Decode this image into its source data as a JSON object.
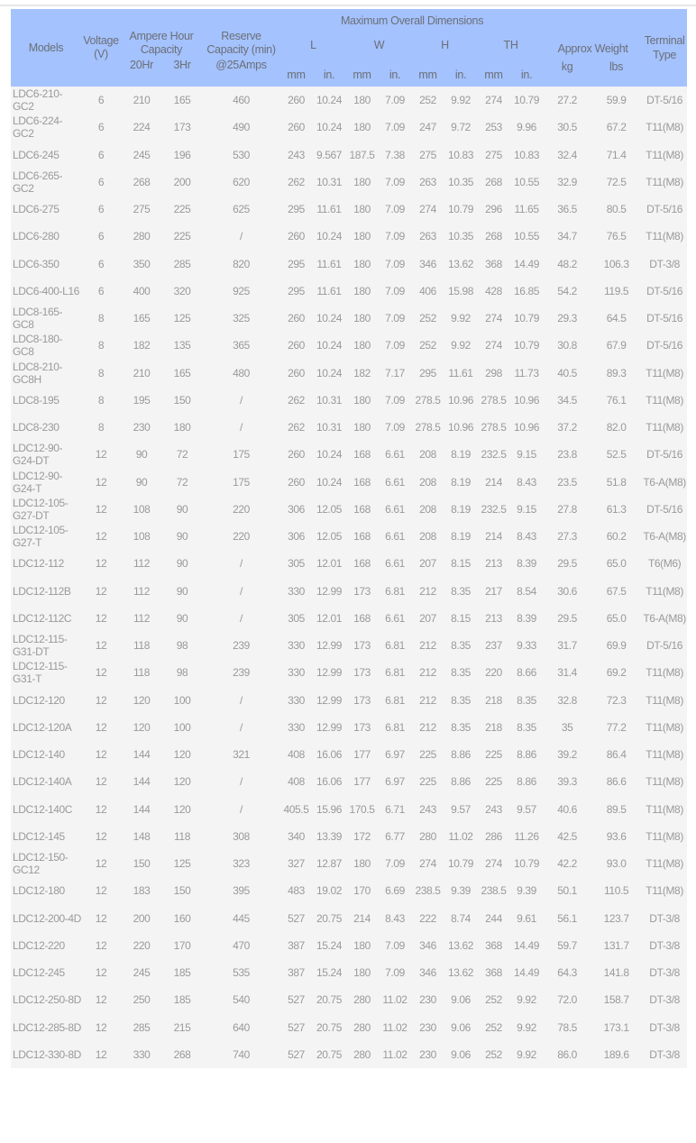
{
  "header": {
    "models": "Models",
    "voltage": "Voltage (V)",
    "ah_capacity": "Ampere Hour Capacity",
    "ah_20hr": "20Hr",
    "ah_3hr": "3Hr",
    "reserve_capacity": "Reserve Capacity (min)",
    "reserve_sub": "@25Amps",
    "max_dimensions": "Maximum Overall Dimensions",
    "dim_L": "L",
    "dim_W": "W",
    "dim_H": "H",
    "dim_TH": "TH",
    "unit_mm": "mm",
    "unit_in": "in.",
    "approx_weight": "Approx Weight",
    "weight_kg": "kg",
    "weight_lbs": "lbs",
    "terminal_type": "Terminal Type"
  },
  "rows": [
    [
      "LDC6-210-GC2",
      "6",
      "210",
      "165",
      "460",
      "260",
      "10.24",
      "180",
      "7.09",
      "252",
      "9.92",
      "274",
      "10.79",
      "27.2",
      "59.9",
      "DT-5/16"
    ],
    [
      "LDC6-224-GC2",
      "6",
      "224",
      "173",
      "490",
      "260",
      "10.24",
      "180",
      "7.09",
      "247",
      "9.72",
      "253",
      "9.96",
      "30.5",
      "67.2",
      "T11(M8)"
    ],
    [
      "LDC6-245",
      "6",
      "245",
      "196",
      "530",
      "243",
      "9.567",
      "187.5",
      "7.38",
      "275",
      "10.83",
      "275",
      "10.83",
      "32.4",
      "71.4",
      "T11(M8)"
    ],
    [
      "LDC6-265-GC2",
      "6",
      "268",
      "200",
      "620",
      "262",
      "10.31",
      "180",
      "7.09",
      "263",
      "10.35",
      "268",
      "10.55",
      "32.9",
      "72.5",
      "T11(M8)"
    ],
    [
      "LDC6-275",
      "6",
      "275",
      "225",
      "625",
      "295",
      "11.61",
      "180",
      "7.09",
      "274",
      "10.79",
      "296",
      "11.65",
      "36.5",
      "80.5",
      "DT-5/16"
    ],
    [
      "LDC6-280",
      "6",
      "280",
      "225",
      "/",
      "260",
      "10.24",
      "180",
      "7.09",
      "263",
      "10.35",
      "268",
      "10.55",
      "34.7",
      "76.5",
      "T11(M8)"
    ],
    [
      "LDC6-350",
      "6",
      "350",
      "285",
      "820",
      "295",
      "11.61",
      "180",
      "7.09",
      "346",
      "13.62",
      "368",
      "14.49",
      "48.2",
      "106.3",
      "DT-3/8"
    ],
    [
      "LDC6-400-L16",
      "6",
      "400",
      "320",
      "925",
      "295",
      "11.61",
      "180",
      "7.09",
      "406",
      "15.98",
      "428",
      "16.85",
      "54.2",
      "119.5",
      "DT-5/16"
    ],
    [
      "LDC8-165-GC8",
      "8",
      "165",
      "125",
      "325",
      "260",
      "10.24",
      "180",
      "7.09",
      "252",
      "9.92",
      "274",
      "10.79",
      "29.3",
      "64.5",
      "DT-5/16"
    ],
    [
      "LDC8-180-GC8",
      "8",
      "182",
      "135",
      "365",
      "260",
      "10.24",
      "180",
      "7.09",
      "252",
      "9.92",
      "274",
      "10.79",
      "30.8",
      "67.9",
      "DT-5/16"
    ],
    [
      "LDC8-210-GC8H",
      "8",
      "210",
      "165",
      "480",
      "260",
      "10.24",
      "182",
      "7.17",
      "295",
      "11.61",
      "298",
      "11.73",
      "40.5",
      "89.3",
      "T11(M8)"
    ],
    [
      "LDC8-195",
      "8",
      "195",
      "150",
      "/",
      "262",
      "10.31",
      "180",
      "7.09",
      "278.5",
      "10.96",
      "278.5",
      "10.96",
      "34.5",
      "76.1",
      "T11(M8)"
    ],
    [
      "LDC8-230",
      "8",
      "230",
      "180",
      "/",
      "262",
      "10.31",
      "180",
      "7.09",
      "278.5",
      "10.96",
      "278.5",
      "10.96",
      "37.2",
      "82.0",
      "T11(M8)"
    ],
    [
      "LDC12-90-G24-DT",
      "12",
      "90",
      "72",
      "175",
      "260",
      "10.24",
      "168",
      "6.61",
      "208",
      "8.19",
      "232.5",
      "9.15",
      "23.8",
      "52.5",
      "DT-5/16"
    ],
    [
      "LDC12-90-G24-T",
      "12",
      "90",
      "72",
      "175",
      "260",
      "10.24",
      "168",
      "6.61",
      "208",
      "8.19",
      "214",
      "8.43",
      "23.5",
      "51.8",
      "T6-A(M8)"
    ],
    [
      "LDC12-105-G27-DT",
      "12",
      "108",
      "90",
      "220",
      "306",
      "12.05",
      "168",
      "6.61",
      "208",
      "8.19",
      "232.5",
      "9.15",
      "27.8",
      "61.3",
      "DT-5/16"
    ],
    [
      "LDC12-105-G27-T",
      "12",
      "108",
      "90",
      "220",
      "306",
      "12.05",
      "168",
      "6.61",
      "208",
      "8.19",
      "214",
      "8.43",
      "27.3",
      "60.2",
      "T6-A(M8)"
    ],
    [
      "LDC12-112",
      "12",
      "112",
      "90",
      "/",
      "305",
      "12.01",
      "168",
      "6.61",
      "207",
      "8.15",
      "213",
      "8.39",
      "29.5",
      "65.0",
      "T6(M6)"
    ],
    [
      "LDC12-112B",
      "12",
      "112",
      "90",
      "/",
      "330",
      "12.99",
      "173",
      "6.81",
      "212",
      "8.35",
      "217",
      "8.54",
      "30.6",
      "67.5",
      "T11(M8)"
    ],
    [
      "LDC12-112C",
      "12",
      "112",
      "90",
      "/",
      "305",
      "12.01",
      "168",
      "6.61",
      "207",
      "8.15",
      "213",
      "8.39",
      "29.5",
      "65.0",
      "T6-A(M8)"
    ],
    [
      "LDC12-115-G31-DT",
      "12",
      "118",
      "98",
      "239",
      "330",
      "12.99",
      "173",
      "6.81",
      "212",
      "8.35",
      "237",
      "9.33",
      "31.7",
      "69.9",
      "DT-5/16"
    ],
    [
      "LDC12-115-G31-T",
      "12",
      "118",
      "98",
      "239",
      "330",
      "12.99",
      "173",
      "6.81",
      "212",
      "8.35",
      "220",
      "8.66",
      "31.4",
      "69.2",
      "T11(M8)"
    ],
    [
      "LDC12-120",
      "12",
      "120",
      "100",
      "/",
      "330",
      "12.99",
      "173",
      "6.81",
      "212",
      "8.35",
      "218",
      "8.35",
      "32.8",
      "72.3",
      "T11(M8)"
    ],
    [
      "LDC12-120A",
      "12",
      "120",
      "100",
      "/",
      "330",
      "12.99",
      "173",
      "6.81",
      "212",
      "8.35",
      "218",
      "8.35",
      "35",
      "77.2",
      "T11(M8)"
    ],
    [
      "LDC12-140",
      "12",
      "144",
      "120",
      "321",
      "408",
      "16.06",
      "177",
      "6.97",
      "225",
      "8.86",
      "225",
      "8.86",
      "39.2",
      "86.4",
      "T11(M8)"
    ],
    [
      "LDC12-140A",
      "12",
      "144",
      "120",
      "/",
      "408",
      "16.06",
      "177",
      "6.97",
      "225",
      "8.86",
      "225",
      "8.86",
      "39.3",
      "86.6",
      "T11(M8)"
    ],
    [
      "LDC12-140C",
      "12",
      "144",
      "120",
      "/",
      "405.5",
      "15.96",
      "170.5",
      "6.71",
      "243",
      "9.57",
      "243",
      "9.57",
      "40.6",
      "89.5",
      "T11(M8)"
    ],
    [
      "LDC12-145",
      "12",
      "148",
      "118",
      "308",
      "340",
      "13.39",
      "172",
      "6.77",
      "280",
      "11.02",
      "286",
      "11.26",
      "42.5",
      "93.6",
      "T11(M8)"
    ],
    [
      "LDC12-150-GC12",
      "12",
      "150",
      "125",
      "323",
      "327",
      "12.87",
      "180",
      "7.09",
      "274",
      "10.79",
      "274",
      "10.79",
      "42.2",
      "93.0",
      "T11(M8)"
    ],
    [
      "LDC12-180",
      "12",
      "183",
      "150",
      "395",
      "483",
      "19.02",
      "170",
      "6.69",
      "238.5",
      "9.39",
      "238.5",
      "9.39",
      "50.1",
      "110.5",
      "T11(M8)"
    ],
    [
      "LDC12-200-4D",
      "12",
      "200",
      "160",
      "445",
      "527",
      "20.75",
      "214",
      "8.43",
      "222",
      "8.74",
      "244",
      "9.61",
      "56.1",
      "123.7",
      "DT-3/8"
    ],
    [
      "LDC12-220",
      "12",
      "220",
      "170",
      "470",
      "387",
      "15.24",
      "180",
      "7.09",
      "346",
      "13.62",
      "368",
      "14.49",
      "59.7",
      "131.7",
      "DT-3/8"
    ],
    [
      "LDC12-245",
      "12",
      "245",
      "185",
      "535",
      "387",
      "15.24",
      "180",
      "7.09",
      "346",
      "13.62",
      "368",
      "14.49",
      "64.3",
      "141.8",
      "DT-3/8"
    ],
    [
      "LDC12-250-8D",
      "12",
      "250",
      "185",
      "540",
      "527",
      "20.75",
      "280",
      "11.02",
      "230",
      "9.06",
      "252",
      "9.92",
      "72.0",
      "158.7",
      "DT-3/8"
    ],
    [
      "LDC12-285-8D",
      "12",
      "285",
      "215",
      "640",
      "527",
      "20.75",
      "280",
      "11.02",
      "230",
      "9.06",
      "252",
      "9.92",
      "78.5",
      "173.1",
      "DT-3/8"
    ],
    [
      "LDC12-330-8D",
      "12",
      "330",
      "268",
      "740",
      "527",
      "20.75",
      "280",
      "11.02",
      "230",
      "9.06",
      "252",
      "9.92",
      "86.0",
      "189.6",
      "DT-3/8"
    ]
  ],
  "colors": {
    "header_bg": "#a4c2fd",
    "header_text": "#6b6f78",
    "body_bg": "#f4f4f4",
    "body_text": "#9a9a9a"
  }
}
